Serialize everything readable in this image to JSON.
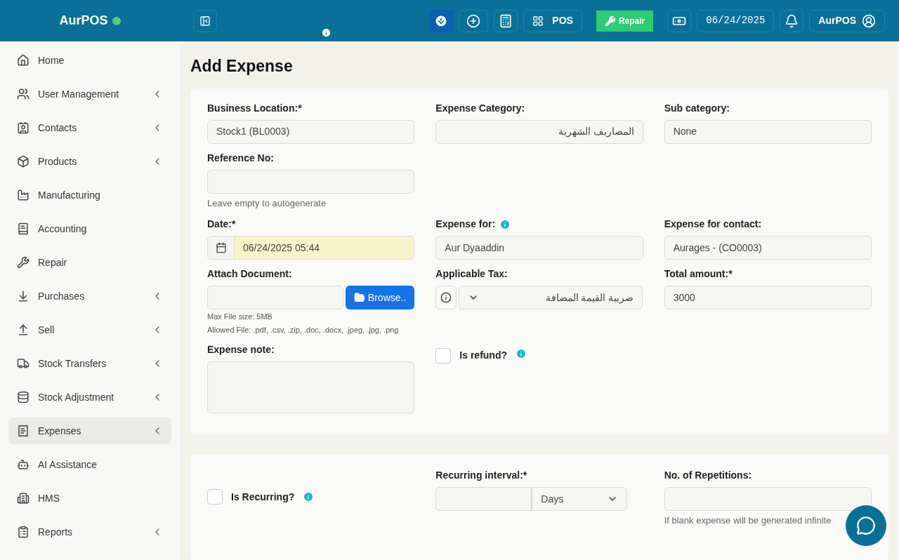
{
  "brand": {
    "name": "AurPOS",
    "online": true
  },
  "header": {
    "pos_label": "POS",
    "repair_label": "Repair",
    "date": "06/24/2025",
    "user": "AurPOS"
  },
  "sidebar": {
    "items": [
      {
        "label": "Home",
        "expandable": false,
        "selected": false
      },
      {
        "label": "User Management",
        "expandable": true,
        "selected": false
      },
      {
        "label": "Contacts",
        "expandable": true,
        "selected": false
      },
      {
        "label": "Products",
        "expandable": true,
        "selected": false
      },
      {
        "label": "Manufacturing",
        "expandable": false,
        "selected": false
      },
      {
        "label": "Accounting",
        "expandable": false,
        "selected": false
      },
      {
        "label": "Repair",
        "expandable": false,
        "selected": false
      },
      {
        "label": "Purchases",
        "expandable": true,
        "selected": false
      },
      {
        "label": "Sell",
        "expandable": true,
        "selected": false
      },
      {
        "label": "Stock Transfers",
        "expandable": true,
        "selected": false
      },
      {
        "label": "Stock Adjustment",
        "expandable": true,
        "selected": false
      },
      {
        "label": "Expenses",
        "expandable": true,
        "selected": true
      },
      {
        "label": "AI Assistance",
        "expandable": false,
        "selected": false
      },
      {
        "label": "HMS",
        "expandable": false,
        "selected": false
      },
      {
        "label": "Reports",
        "expandable": true,
        "selected": false
      }
    ]
  },
  "page_title": "Add Expense",
  "form": {
    "business_location": {
      "label": "Business Location:*",
      "value": "Stock1 (BL0003)"
    },
    "expense_category": {
      "label": "Expense Category:",
      "value": "المصاريف الشهرية"
    },
    "sub_category": {
      "label": "Sub category:",
      "value": "None"
    },
    "reference_no": {
      "label": "Reference No:",
      "help": "Leave empty to autogenerate"
    },
    "date": {
      "label": "Date:*",
      "value": "06/24/2025 05:44"
    },
    "expense_for": {
      "label": "Expense for:",
      "value": "Aur Dyaaddin"
    },
    "expense_for_contact": {
      "label": "Expense for contact:",
      "value": "Aurages - (CO0003)"
    },
    "attach_document": {
      "label": "Attach Document:",
      "button": "Browse..",
      "help_lines": [
        "Max File size: 5MB",
        "Allowed File: .pdf, .csv, .zip, .doc, .docx, .jpeg, .jpg, .png"
      ]
    },
    "applicable_tax": {
      "label": "Applicable Tax:",
      "value": "ضريبة القيمة المضافة"
    },
    "total_amount": {
      "label": "Total amount:*",
      "value": "3000"
    },
    "expense_note": {
      "label": "Expense note:"
    },
    "is_refund": {
      "label": "Is refund?",
      "checked": false
    }
  },
  "recurring": {
    "is_recurring": {
      "label": "Is Recurring?",
      "checked": false
    },
    "interval": {
      "label": "Recurring interval:*",
      "unit": "Days"
    },
    "repetitions": {
      "label": "No. of Repetitions:",
      "help": "If blank expense will be generated infinite"
    }
  }
}
